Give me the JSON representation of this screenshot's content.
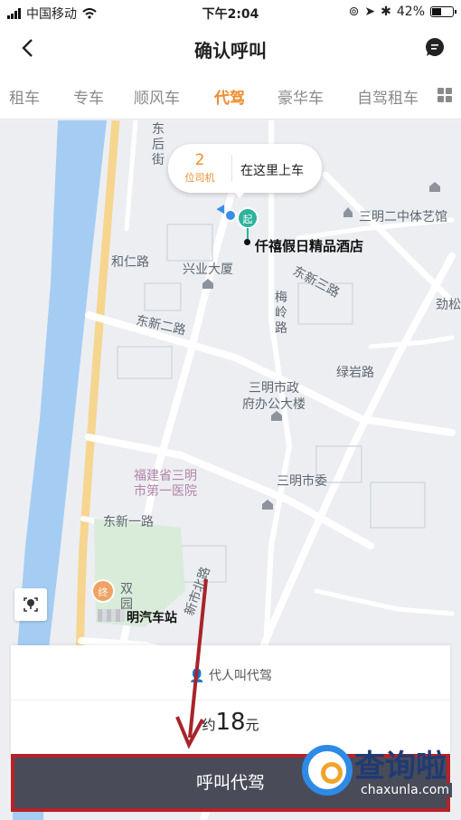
{
  "status_bar": {
    "carrier": "中国移动",
    "time": "下午2:04",
    "battery": "42%"
  },
  "nav": {
    "title": "确认呼叫"
  },
  "tabs": [
    {
      "label": "租车"
    },
    {
      "label": "专车"
    },
    {
      "label": "顺风车"
    },
    {
      "label": "代驾",
      "active": true
    },
    {
      "label": "豪华车"
    },
    {
      "label": "自驾租车"
    }
  ],
  "bubble": {
    "driver_count": "2",
    "driver_unit": "位司机",
    "action": "在这里上车"
  },
  "markers": {
    "start_label": "起",
    "end_label": "终"
  },
  "map_labels": {
    "dongfanghou": "东后街",
    "heren": "和仁路",
    "xingye": "兴业大厦",
    "start_poi": "仟禧假日精品酒店",
    "culture": "三明二中体艺馆",
    "jinsong": "劲松",
    "dongxin3": "东新三路",
    "meiling": "梅岭路",
    "dongxin2": "东新二路",
    "luyan": "绿岩路",
    "gov1": "三明市政",
    "gov2": "府办公大楼",
    "party": "三明市委",
    "hosp1": "福建省三明",
    "hosp2": "市第一医院",
    "dongxin1": "东新一路",
    "xincheng": "新市北路",
    "shuang": "双",
    "yuan": "园",
    "bus_station": "明汽车站"
  },
  "panel": {
    "proxy_label": "代人叫代驾",
    "price_prefix": "约",
    "price_amount": "18",
    "price_unit": "元",
    "call_button": "呼叫代驾"
  },
  "watermark": {
    "brand_cn": "查询啦",
    "brand_en": "chaxunla.com"
  },
  "colors": {
    "accent": "#f08c2e",
    "start_marker": "#2bb39b",
    "call_button_bg": "#4a4b59",
    "highlight_border": "#b82127",
    "river": "#a5cdf3",
    "main_road": "#f6d58f"
  }
}
